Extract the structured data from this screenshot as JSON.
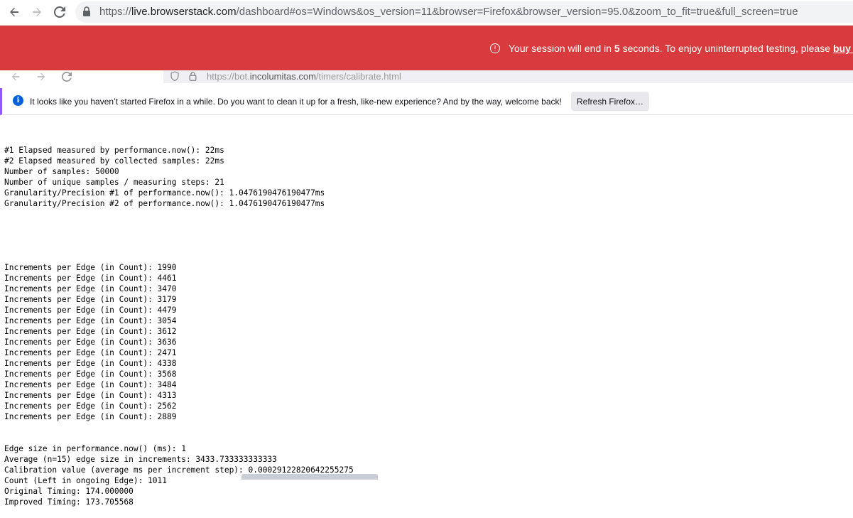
{
  "outer_browser": {
    "url_prefix": "https://",
    "url_host": "live.browserstack.com",
    "url_rest": "/dashboard#os=Windows&os_version=11&browser=Firefox&browser_version=95.0&zoom_to_fit=true&full_screen=true"
  },
  "session_banner": {
    "text_before": "Your session will end in",
    "seconds": "5",
    "text_after": "seconds. To enjoy uninterrupted testing, please",
    "link_text": "buy a p"
  },
  "inner_browser": {
    "url_prefix": "https://bot.",
    "url_host": "incolumitas.com",
    "url_rest": "/timers/calibrate.html"
  },
  "notification": {
    "message": "It looks like you haven’t started Firefox in a while. Do you want to clean it up for a fresh, like-new experience? And by the way, welcome back!",
    "button_label": "Refresh Firefox…"
  },
  "timing": {
    "header_lines": [
      "#1 Elapsed measured by performance.now(): 22ms",
      "#2 Elapsed measured by collected samples: 22ms",
      "Number of samples: 50000",
      "Number of unique samples / measuring steps: 21",
      "Granularity/Precision #1 of performance.now(): 1.0476190476190477ms",
      "Granularity/Precision #2 of performance.now(): 1.0476190476190477ms"
    ],
    "increments_label": "Increments per Edge (in Count): ",
    "increments": [
      "1990",
      "4461",
      "3470",
      "3179",
      "4479",
      "3054",
      "3612",
      "3636",
      "2471",
      "4338",
      "3568",
      "3484",
      "4313",
      "2562",
      "2889"
    ],
    "footer_lines": [
      "Edge size in performance.now() (ms): 1",
      "Average (n=15) edge size in increments: 3433.733333333333",
      "Calibration value (average ms per increment step): 0.00029122820642255275",
      "Count (Left in ongoing Edge): 1011",
      "Original Timing: 174.000000",
      "Improved Timing: 173.705568"
    ]
  },
  "icons": {
    "back": "arrow-left-icon",
    "forward": "arrow-right-icon",
    "reload": "reload-icon",
    "lock": "lock-icon",
    "info": "info-icon",
    "shield": "shield-icon"
  },
  "colors": {
    "banner": "#d93a3e",
    "firefox_accent": "#9059ff",
    "info_blue": "#0060df"
  }
}
